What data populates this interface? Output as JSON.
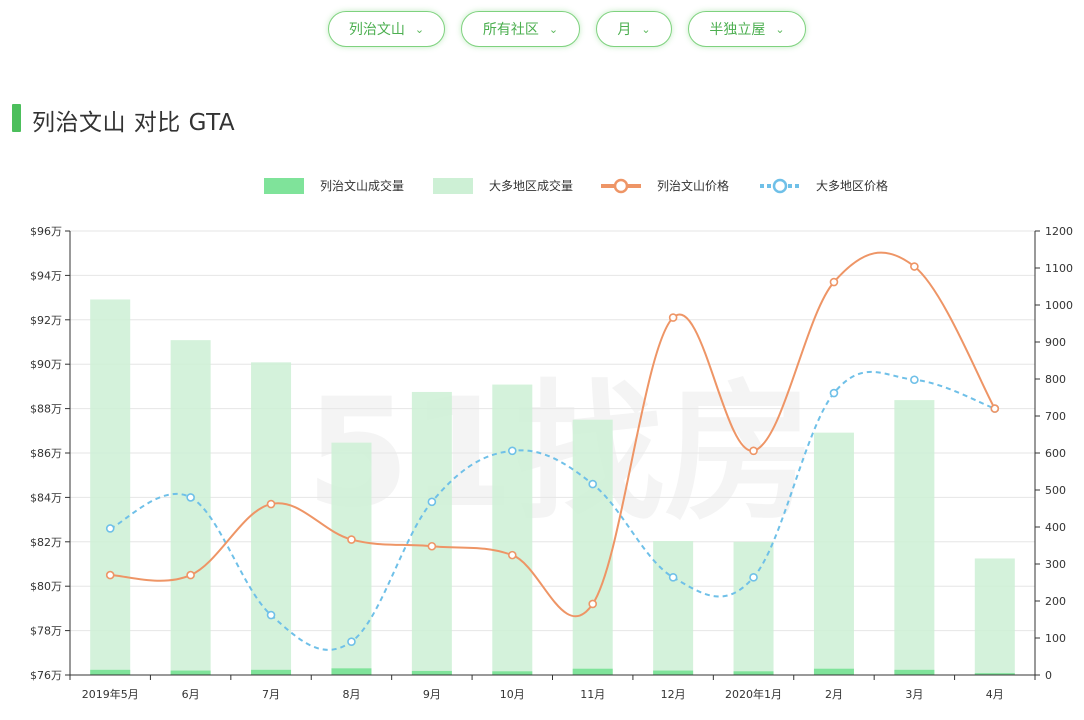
{
  "filters": [
    {
      "label": "列治文山",
      "chevron_icon": "chevron-down-icon"
    },
    {
      "label": "所有社区",
      "chevron_icon": "chevron-down-icon"
    },
    {
      "label": "月",
      "chevron_icon": "chevron-down-icon"
    },
    {
      "label": "半独立屋",
      "chevron_icon": "chevron-down-icon"
    }
  ],
  "heading": {
    "title": "列治文山 对比 GTA"
  },
  "watermark": "51找房",
  "chart_data": {
    "type": "bar",
    "categories": [
      "2019年5月",
      "6月",
      "7月",
      "8月",
      "9月",
      "10月",
      "11月",
      "12月",
      "2020年1月",
      "2月",
      "3月",
      "4月"
    ],
    "y_left": {
      "ticks": [
        "$76万",
        "$78万",
        "$80万",
        "$82万",
        "$84万",
        "$86万",
        "$88万",
        "$90万",
        "$92万",
        "$94万",
        "$96万"
      ],
      "min": 76,
      "max": 96,
      "unit": "万"
    },
    "y_right": {
      "ticks": [
        "0",
        "100",
        "200",
        "300",
        "400",
        "500",
        "600",
        "700",
        "800",
        "900",
        "1000",
        "1100",
        "1200"
      ],
      "min": 0,
      "max": 1200
    },
    "grid": true,
    "legend_position": "top",
    "series": [
      {
        "name": "列治文山成交量",
        "kind": "bar",
        "axis": "right",
        "color": "#7fe39a",
        "values": [
          14,
          12,
          14,
          18,
          11,
          10,
          17,
          12,
          10,
          17,
          14,
          5
        ]
      },
      {
        "name": "大多地区成交量",
        "kind": "bar",
        "axis": "right",
        "color": "#cdf0d5",
        "values": [
          1015,
          905,
          845,
          628,
          765,
          785,
          690,
          362,
          360,
          655,
          743,
          315
        ]
      },
      {
        "name": "列治文山价格",
        "kind": "line",
        "axis": "left",
        "color": "#ee9566",
        "dashed": false,
        "values": [
          80.5,
          80.5,
          83.7,
          82.1,
          81.8,
          81.4,
          79.2,
          92.1,
          86.1,
          93.7,
          94.4,
          88.0
        ]
      },
      {
        "name": "大多地区价格",
        "kind": "line",
        "axis": "left",
        "color": "#6fc0e8",
        "dashed": true,
        "values": [
          82.6,
          84.0,
          78.7,
          77.5,
          83.8,
          86.1,
          84.6,
          80.4,
          80.4,
          88.7,
          89.3,
          88.0
        ]
      }
    ]
  }
}
